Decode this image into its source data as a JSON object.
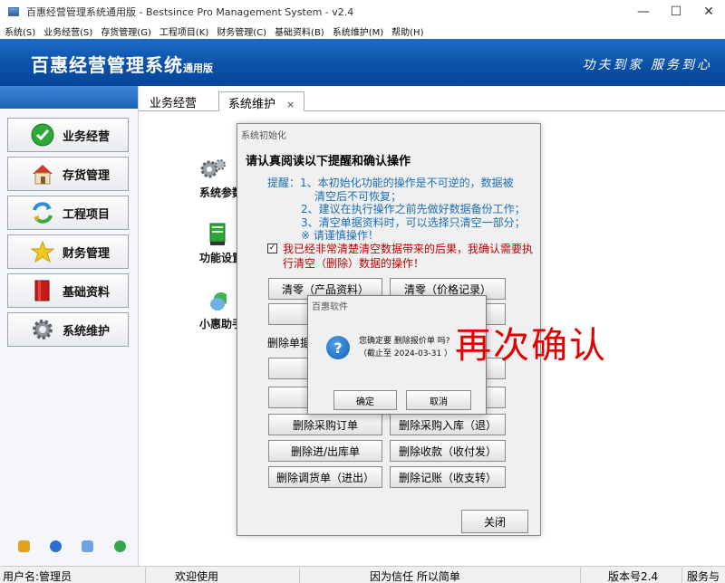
{
  "window": {
    "title": "百惠经营管理系统通用版 - Bestsince Pro Management System - v2.4",
    "minimize": "—",
    "maximize": "☐",
    "close": "✕"
  },
  "menu": [
    "系统(S)",
    "业务经营(S)",
    "存货管理(G)",
    "工程项目(K)",
    "财务管理(C)",
    "基础资料(B)",
    "系统维护(M)",
    "帮助(H)"
  ],
  "banner": {
    "brand": "百惠经营管理系统",
    "brand_sub": "通用版",
    "slogan": "功夫到家 服务到心"
  },
  "sidebar": {
    "items": [
      {
        "label": "业务经营",
        "icon": "check-circle-icon"
      },
      {
        "label": "存货管理",
        "icon": "house-icon"
      },
      {
        "label": "工程项目",
        "icon": "recycle-arrows-icon"
      },
      {
        "label": "财务管理",
        "icon": "star-icon"
      },
      {
        "label": "基础资料",
        "icon": "book-icon"
      },
      {
        "label": "系统维护",
        "icon": "gear-icon"
      }
    ]
  },
  "tabs": [
    {
      "label": "业务经营"
    },
    {
      "label": "系统维护",
      "close": "×"
    }
  ],
  "main_icons": [
    {
      "label": "系统参数",
      "icon": "gears-icon"
    },
    {
      "label": "功能设置",
      "icon": "server-icon"
    },
    {
      "label": "小惠助手",
      "icon": "chat-bubbles-icon"
    }
  ],
  "init_dialog": {
    "title": "系统初始化",
    "heading": "请认真阅读以下提醒和确认操作",
    "reminders": [
      "提醒：1、本初始化功能的操作是不可逆的，数据被",
      "清空后不可恢复；",
      "2、建议在执行操作之前先做好数据备份工作；",
      "3、清空单据资料时，可以选择只清空一部分；",
      "※  请谨慎操作！"
    ],
    "checkbox_mark": "✓",
    "confirm_text": "我已经非常清楚清空数据带来的后果，我确认需要执行清空（删除）数据的操作！",
    "buttons_top": [
      "清零（产品资料）",
      "清零（价格记录）",
      "清零",
      ""
    ],
    "section_label": "删除单据",
    "buttons_left": [
      "删除进",
      "删",
      "删除采购订单",
      "删除进/出库单",
      "删除调货单（进出）"
    ],
    "buttons_right": [
      "",
      "",
      "删除采购入库（退）",
      "删除收款（收付发）",
      "删除记账（收支转）"
    ],
    "close_button": "关闭"
  },
  "confirm_dialog": {
    "title": "百惠软件",
    "icon": "question-icon",
    "icon_glyph": "?",
    "message": "您确定要 删除报价单 吗?",
    "sub_message": "（截止至 2024-03-31 ）",
    "ok": "确定",
    "cancel": "取消"
  },
  "annotation": "再次确认",
  "statusbar": {
    "user": "用户名:管理员",
    "welcome": "欢迎使用",
    "motto": "因为信任 所以简单",
    "version": "版本号2.4",
    "service": "服务与"
  }
}
